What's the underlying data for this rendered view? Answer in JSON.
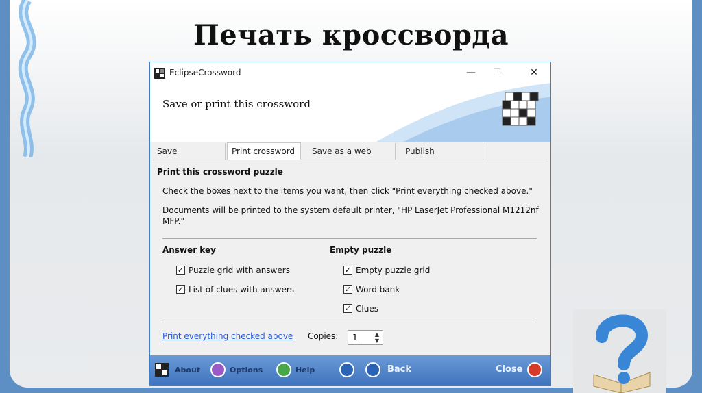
{
  "slide": {
    "title": "Печать кроссворда"
  },
  "window": {
    "title": "EclipseCrossword",
    "minimize": "—",
    "maximize": "☐",
    "close": "✕",
    "banner_title": "Save or print this crossword"
  },
  "tabs": [
    {
      "label": "Save crossword",
      "active": false
    },
    {
      "label": "Print crossword",
      "active": true
    },
    {
      "label": "Save as a web page",
      "active": false
    },
    {
      "label": "Publish crossword",
      "active": false
    }
  ],
  "print_pane": {
    "heading": "Print this crossword puzzle",
    "instructions": "Check the boxes next to the items you want, then click \"Print everything checked above.\"",
    "printer_line1": "Documents will be printed to the system default printer, \"HP LaserJet Professional M1212nf",
    "printer_line2": "MFP.\"",
    "answer_key": {
      "heading": "Answer key",
      "items": [
        {
          "label": "Puzzle grid with answers",
          "checked": true
        },
        {
          "label": "List of clues with answers",
          "checked": true
        }
      ]
    },
    "empty_puzzle": {
      "heading": "Empty puzzle",
      "items": [
        {
          "label": "Empty puzzle grid",
          "checked": true
        },
        {
          "label": "Word bank",
          "checked": true
        },
        {
          "label": "Clues",
          "checked": true
        }
      ]
    },
    "print_link": "Print everything checked above",
    "copies_label": "Copies:",
    "copies_value": "1"
  },
  "bottom_bar": {
    "about": "About",
    "options": "Options",
    "help": "Help",
    "back": "Back",
    "close": "Close"
  },
  "colors": {
    "window_border": "#3c7ccb",
    "bottom_bar": "#4a7fc6",
    "link": "#2a5bd7",
    "slide_frame": "#5d8fc4"
  }
}
